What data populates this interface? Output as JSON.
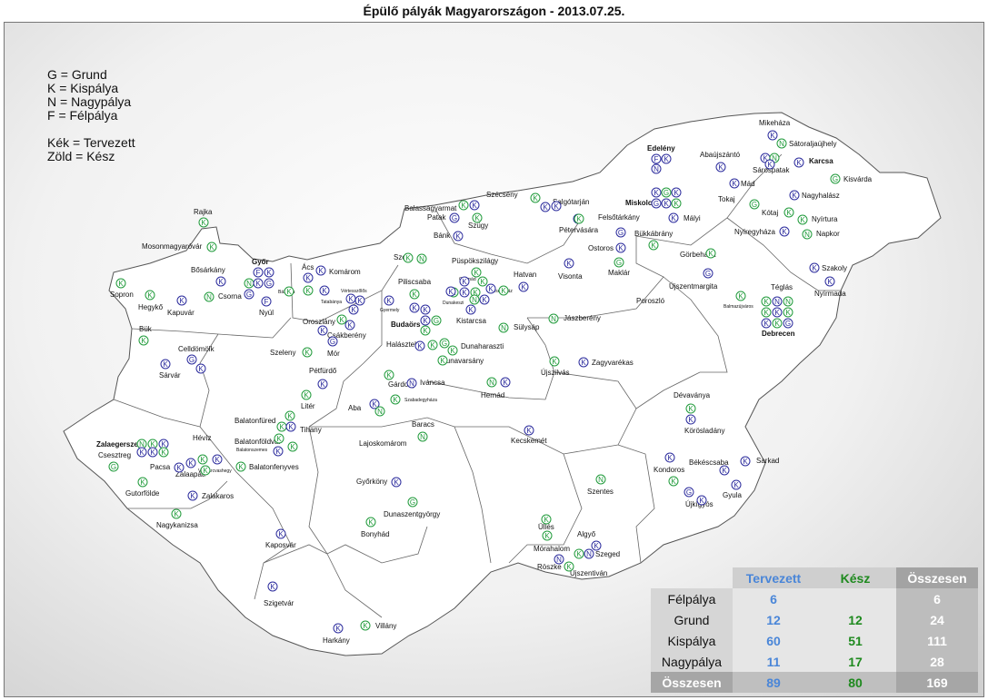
{
  "title": "Épülő pályák Magyarországon - 2013.07.25.",
  "legend": {
    "lines": [
      "G = Grund",
      "K = Kispálya",
      "N = Nagypálya",
      "F = Félpálya"
    ],
    "color_lines": [
      "Kék = Tervezett",
      "Zöld = Kész"
    ]
  },
  "colors": {
    "planned": "#2a2a9c",
    "done": "#1f9a3a",
    "planned_header": "#4a86d8",
    "done_header": "#1f8a1f"
  },
  "places": [
    "Mikeháza",
    "Sátoraljaújhely",
    "Edelény",
    "Abaújszántó",
    "Sárospatak",
    "Karcsa",
    "Kisvárda",
    "Mád",
    "Tokaj",
    "Nagyhalász",
    "Szécsény",
    "Salgótarján",
    "Miskolc",
    "Balassagyarmat",
    "Patak",
    "Szügy",
    "Felsőtárkány",
    "Mályi",
    "Kótaj",
    "Nyírtura",
    "Bánk",
    "Pétervására",
    "Bükkábrány",
    "Nyíregyháza",
    "Napkor",
    "Rajka",
    "Ostoros",
    "Mosonmagyaróvár",
    "Görbeháza",
    "Szob",
    "Püspökszilágy",
    "Maklár",
    "Szakoly",
    "Győr",
    "Bősárkány",
    "Ács",
    "Komárom",
    "Csomád",
    "Hatvan",
    "Visonta",
    "Piliscsaba",
    "Újszentmargita",
    "Téglás",
    "Nyírmada",
    "Sopron",
    "Csorna",
    "Veresegyház",
    "Tatabánya",
    "Vértesszőlős",
    "Bábolna",
    "Dunakeszi",
    "Poroszló",
    "Balmazújváros",
    "Kapuvár",
    "Nyúl",
    "Budaörs",
    "Kistarcsa",
    "Gyermely",
    "Oroszlány",
    "Jászberény",
    "Hegykő",
    "Sülysáp",
    "Debrecen",
    "Bük",
    "Csákberény",
    "Halásztelek",
    "Dunaharaszti",
    "Celldömölk",
    "Mór",
    "Dunavarsány",
    "Sárvár",
    "Szeleny",
    "Pétfürdő",
    "Újszilvás",
    "Zagyvarékas",
    "Gárdony",
    "Iváncsa",
    "Hernád",
    "Szabadegyháza",
    "Aba",
    "Dévaványa",
    "Litér",
    "Balatonfüred",
    "Tihany",
    "Baracs",
    "Körösladány",
    "Kecskemét",
    "Zalaegerszeg",
    "Hévíz",
    "Balatonföldvár",
    "Balatonszemes",
    "Lajoskomárom",
    "Csesztreg",
    "Pacsa",
    "Zalaapáti",
    "Vonyarcvashegy",
    "Balatonfenyves",
    "Kondoros",
    "Békéscsaba",
    "Sarkad",
    "Gutorfölde",
    "Zalakaros",
    "Szentes",
    "Győrköny",
    "Gyula",
    "Újkígyós",
    "Nagykanizsa",
    "Dunaszentgyörgy",
    "Üllés",
    "Algyő",
    "Bonyhád",
    "Mórahalom",
    "Szeged",
    "Kaposvár",
    "Röszke",
    "Újszentiván",
    "Szigetvár",
    "Villány",
    "Harkány"
  ],
  "markers": [
    [
      "K",
      "b"
    ],
    [
      "N",
      "g"
    ],
    [
      "F",
      "b"
    ],
    [
      "N",
      "b"
    ],
    [
      "K",
      "b"
    ],
    [
      "K",
      "b"
    ],
    [
      "N",
      "g"
    ],
    [
      "K",
      "b"
    ],
    [
      "K",
      "b"
    ],
    [
      "G",
      "g"
    ],
    [
      "K",
      "b"
    ],
    [
      "K",
      "b"
    ],
    [
      "K",
      "b"
    ],
    [
      "G",
      "g"
    ],
    [
      "K",
      "g"
    ],
    [
      "K",
      "g"
    ],
    [
      "N",
      "g"
    ],
    [
      "K",
      "b"
    ],
    [
      "K",
      "b"
    ],
    [
      "G",
      "g"
    ],
    [
      "K",
      "b"
    ],
    [
      "G",
      "b"
    ],
    [
      "K",
      "b"
    ],
    [
      "K",
      "g"
    ],
    [
      "K",
      "b"
    ],
    [
      "G",
      "b"
    ],
    [
      "K",
      "g"
    ],
    [
      "F",
      "b"
    ],
    [
      "K",
      "b"
    ],
    [
      "G",
      "g"
    ],
    [
      "K",
      "g"
    ],
    [
      "G",
      "b"
    ],
    [
      "K",
      "g"
    ],
    [
      "K",
      "b"
    ],
    [
      "K",
      "b"
    ],
    [
      "K",
      "g"
    ],
    [
      "N",
      "b"
    ],
    [
      "N",
      "g"
    ],
    [
      "K",
      "g"
    ],
    [
      "K",
      "b"
    ],
    [
      "K",
      "g"
    ],
    [
      "K",
      "b"
    ],
    [
      "K",
      "g"
    ],
    [
      "G",
      "b"
    ],
    [
      "K",
      "g"
    ],
    [
      "K",
      "b"
    ],
    [
      "G",
      "b"
    ],
    [
      "K",
      "g"
    ],
    [
      "K",
      "b"
    ],
    [
      "K",
      "g"
    ],
    [
      "N",
      "g"
    ],
    [
      "K",
      "g"
    ],
    [
      "K",
      "b"
    ],
    [
      "K",
      "b"
    ],
    [
      "K",
      "g"
    ],
    [
      "K",
      "b"
    ],
    [
      "K",
      "b"
    ],
    [
      "N",
      "g"
    ],
    [
      "K",
      "g"
    ],
    [
      "K",
      "b"
    ],
    [
      "K",
      "g"
    ],
    [
      "K",
      "g"
    ],
    [
      "K",
      "b"
    ],
    [
      "K",
      "g"
    ],
    [
      "K",
      "b"
    ],
    [
      "N",
      "g"
    ],
    [
      "K",
      "b"
    ],
    [
      "K",
      "g"
    ],
    [
      "K",
      "b"
    ],
    [
      "G",
      "g"
    ],
    [
      "K",
      "b"
    ],
    [
      "K",
      "b"
    ],
    [
      "K",
      "g"
    ],
    [
      "K",
      "b"
    ],
    [
      "K",
      "b"
    ],
    [
      "K",
      "g"
    ],
    [
      "K",
      "b"
    ],
    [
      "K",
      "b"
    ],
    [
      "K",
      "b"
    ],
    [
      "K",
      "b"
    ],
    [
      "K",
      "g"
    ],
    [
      "K",
      "b"
    ],
    [
      "G",
      "b"
    ],
    [
      "K",
      "b"
    ],
    [
      "K",
      "b"
    ],
    [
      "K",
      "g"
    ],
    [
      "K",
      "b"
    ],
    [
      "K",
      "g"
    ],
    [
      "F",
      "b"
    ],
    [
      "K",
      "b"
    ],
    [
      "N",
      "g"
    ],
    [
      "K",
      "b"
    ],
    [
      "G",
      "b"
    ],
    [
      "G",
      "b"
    ],
    [
      "F",
      "b"
    ],
    [
      "K",
      "g"
    ],
    [
      "K",
      "g"
    ],
    [
      "K",
      "b"
    ],
    [
      "N",
      "g"
    ],
    [
      "K",
      "b"
    ],
    [
      "K",
      "g"
    ],
    [
      "K",
      "g"
    ],
    [
      "K",
      "g"
    ],
    [
      "K",
      "b"
    ],
    [
      "G",
      "b"
    ],
    [
      "K",
      "b"
    ],
    [
      "K",
      "g"
    ],
    [
      "K",
      "b"
    ],
    [
      "K",
      "b"
    ],
    [
      "K",
      "g"
    ],
    [
      "K",
      "b"
    ],
    [
      "N",
      "g"
    ],
    [
      "K",
      "g"
    ],
    [
      "K",
      "g"
    ],
    [
      "N",
      "b"
    ],
    [
      "K",
      "g"
    ],
    [
      "G",
      "g"
    ],
    [
      "K",
      "b"
    ],
    [
      "K",
      "g"
    ],
    [
      "K",
      "g"
    ],
    [
      "N",
      "g"
    ],
    [
      "K",
      "b"
    ],
    [
      "K",
      "g"
    ],
    [
      "K",
      "b"
    ],
    [
      "N",
      "g"
    ],
    [
      "K",
      "b"
    ],
    [
      "N",
      "g"
    ],
    [
      "K",
      "b"
    ],
    [
      "G",
      "g"
    ],
    [
      "N",
      "g"
    ],
    [
      "K",
      "g"
    ],
    [
      "K",
      "b"
    ],
    [
      "K",
      "b"
    ],
    [
      "K",
      "g"
    ],
    [
      "G",
      "b"
    ],
    [
      "K",
      "b"
    ],
    [
      "K",
      "b"
    ],
    [
      "K",
      "b"
    ],
    [
      "K",
      "b"
    ],
    [
      "K",
      "b"
    ],
    [
      "K",
      "g"
    ],
    [
      "K",
      "b"
    ],
    [
      "K",
      "g"
    ],
    [
      "K",
      "b"
    ],
    [
      "K",
      "g"
    ],
    [
      "K",
      "g"
    ],
    [
      "K",
      "b"
    ],
    [
      "K",
      "g"
    ],
    [
      "N",
      "g"
    ],
    [
      "K",
      "g"
    ],
    [
      "K",
      "b"
    ],
    [
      "K",
      "b"
    ],
    [
      "K",
      "b"
    ],
    [
      "K",
      "g"
    ],
    [
      "G",
      "g"
    ],
    [
      "K",
      "g"
    ],
    [
      "K",
      "b"
    ],
    [
      "N",
      "b"
    ],
    [
      "K",
      "g"
    ],
    [
      "K",
      "g"
    ],
    [
      "N",
      "b"
    ],
    [
      "K",
      "g"
    ],
    [
      "K",
      "b"
    ],
    [
      "K",
      "g"
    ],
    [
      "K",
      "g"
    ],
    [
      "K",
      "b"
    ],
    [
      "K",
      "b"
    ],
    [
      "K",
      "b"
    ],
    [
      "K",
      "g"
    ],
    [
      "K",
      "g"
    ],
    [
      "K",
      "g"
    ],
    [
      "K",
      "b"
    ],
    [
      "K",
      "g"
    ]
  ],
  "stats": {
    "headers": [
      "Tervezett",
      "Kész",
      "Összesen"
    ],
    "rows": [
      {
        "label": "Félpálya",
        "planned": "6",
        "done": "",
        "total": "6"
      },
      {
        "label": "Grund",
        "planned": "12",
        "done": "12",
        "total": "24"
      },
      {
        "label": "Kispálya",
        "planned": "60",
        "done": "51",
        "total": "111"
      },
      {
        "label": "Nagypálya",
        "planned": "11",
        "done": "17",
        "total": "28"
      }
    ],
    "sum": {
      "label": "Összesen",
      "planned": "89",
      "done": "80",
      "total": "169"
    }
  }
}
